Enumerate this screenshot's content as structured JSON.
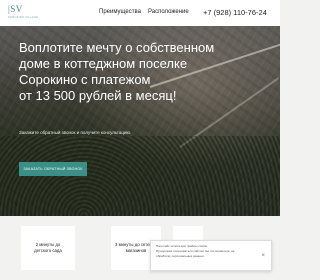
{
  "header": {
    "logo_mark": "|SV",
    "logo_sub": "SOROKINO VILLAGE",
    "nav": [
      "Преимущества",
      "Расположение"
    ],
    "phone": "+7 (928) 110-76-24"
  },
  "hero": {
    "headline_lines": [
      "Воплотите мечту о собственном",
      "доме в коттеджном поселке",
      "Сорокино с платежом",
      "от 13 500 рублей в месяц!"
    ],
    "subline": "Закажите обратный звонок и получите консультацию.",
    "cta_label": "ЗАКАЗАТЬ ОБРАТНЫЙ ЗВОНОК"
  },
  "features": [
    {
      "line1": "2 минуты до",
      "line2": "детского сада"
    },
    {
      "line1": "3 минуты до сетевых",
      "line2": "магазинов"
    },
    {
      "line1": "",
      "line2": ""
    }
  ],
  "cookie": {
    "lines": [
      "Наш сайт использует файлы cookie.",
      "Продолжая пользоваться сайтом, вы соглашаетесь на",
      "обработку персональных данных."
    ],
    "close_symbol": "×"
  },
  "colors": {
    "accent": "#3a8f86"
  }
}
